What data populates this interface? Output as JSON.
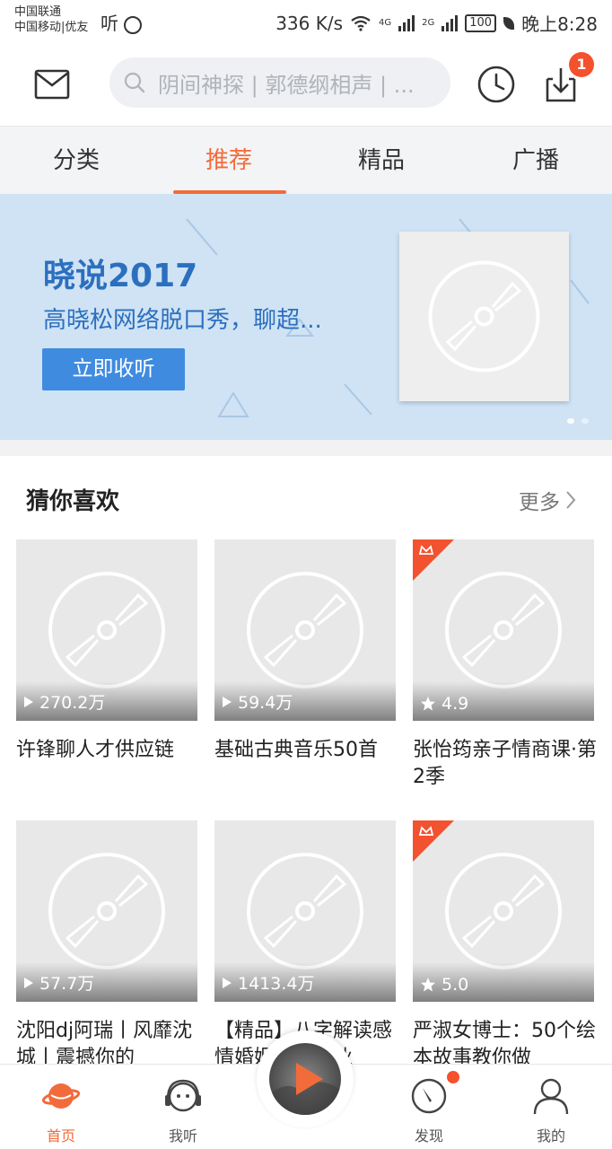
{
  "status_bar": {
    "carrier_1": "中国联通",
    "carrier_2": "中国移动|优友",
    "app_glyph": "听",
    "speed": "336 K/s",
    "net_1": "4G",
    "net_2": "2G",
    "battery": "100",
    "time": "晚上8:28"
  },
  "header": {
    "search_placeholder": "阴间神探 | 郭德纲相声 | ...",
    "download_badge": "1"
  },
  "tabs": [
    {
      "label": "分类"
    },
    {
      "label": "推荐"
    },
    {
      "label": "精品"
    },
    {
      "label": "广播"
    }
  ],
  "active_tab": "推荐",
  "banner": {
    "title": "晓说2017",
    "subtitle": "高晓松网络脱口秀，聊超...",
    "button": "立即收听"
  },
  "section": {
    "title": "猜你喜欢",
    "more": "更多"
  },
  "cards": [
    {
      "stat_type": "plays",
      "stat": "270.2万",
      "title": "许锋聊人才供应链",
      "paid": false
    },
    {
      "stat_type": "plays",
      "stat": "59.4万",
      "title": "基础古典音乐50首",
      "paid": false
    },
    {
      "stat_type": "rating",
      "stat": "4.9",
      "title": "张怡筠亲子情商课·第2季",
      "paid": true
    },
    {
      "stat_type": "plays",
      "stat": "57.7万",
      "title": "沈阳dj阿瑞丨风靡沈城丨震撼你的",
      "paid": false
    },
    {
      "stat_type": "plays",
      "stat": "1413.4万",
      "title": "【精品】八字解读感情婚姻财运事业",
      "paid": false
    },
    {
      "stat_type": "rating",
      "stat": "5.0",
      "title": "严淑女博士：50个绘本故事教你做",
      "paid": true
    }
  ],
  "bottom_nav": [
    {
      "label": "首页",
      "icon": "planet-icon",
      "active": true
    },
    {
      "label": "我听",
      "icon": "headphones-face-icon",
      "active": false
    },
    {
      "label": "发现",
      "icon": "compass-icon",
      "active": false
    },
    {
      "label": "我的",
      "icon": "person-icon",
      "active": false
    }
  ],
  "colors": {
    "accent": "#f26b3a",
    "badge": "#f4512c",
    "banner_bg": "#cfe3f5",
    "banner_text": "#2c6fbf",
    "banner_button": "#3f8be0"
  }
}
